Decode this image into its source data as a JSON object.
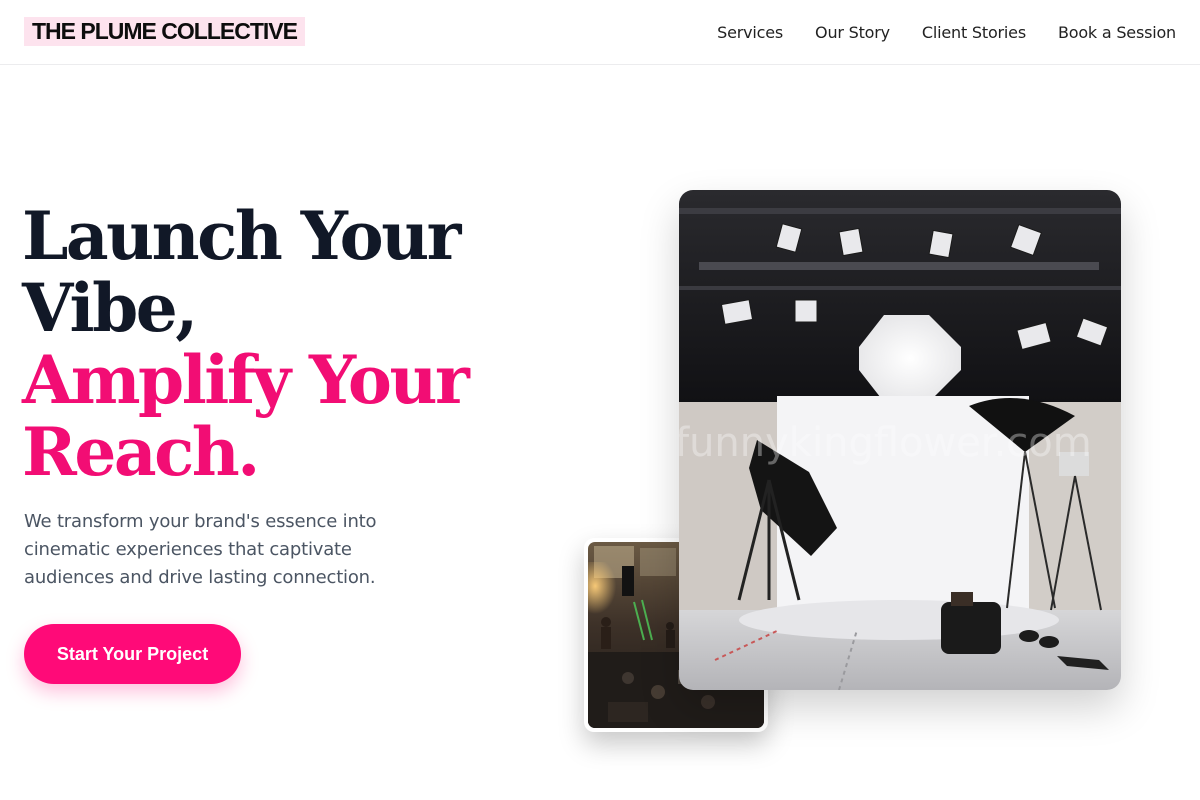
{
  "brand": {
    "logo_text": "THE PLUME COLLECTIVE",
    "logo_highlight_color": "#fde3ee"
  },
  "nav": {
    "links": [
      {
        "label": "Services"
      },
      {
        "label": "Our Story"
      },
      {
        "label": "Client Stories"
      },
      {
        "label": "Book a Session"
      }
    ]
  },
  "hero": {
    "headline": {
      "line1": "Launch Your",
      "line2": "Vibe,",
      "line3": "Amplify Your",
      "line4": "Reach."
    },
    "subtext": "We transform your brand's essence into cinematic experiences that captivate audiences and drive lasting connection.",
    "cta_label": "Start Your Project"
  },
  "images": {
    "main_watermark": "funnykingflower.com"
  },
  "colors": {
    "accent": "#ff0a78",
    "headline_dark": "#111827",
    "headline_pink": "#f20d74",
    "body_text": "#4b5563"
  }
}
